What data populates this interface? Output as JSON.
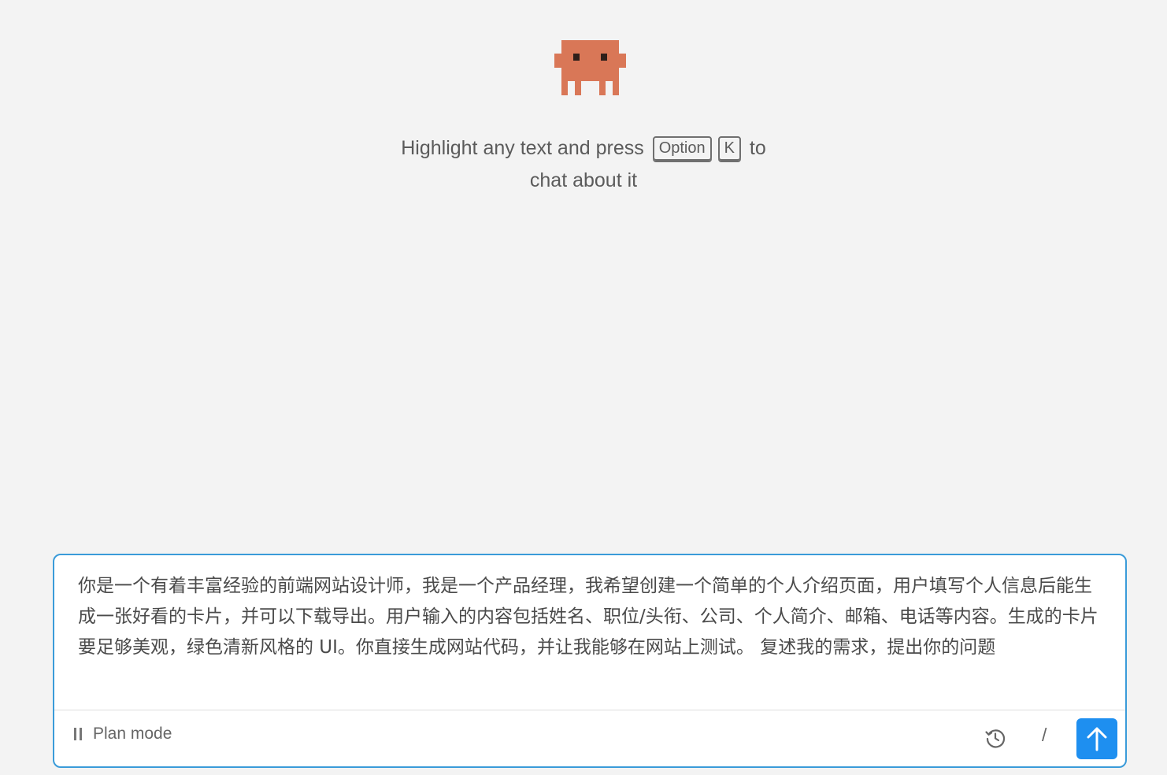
{
  "hint": {
    "line1_text": "Highlight any text and press",
    "key1": "Option",
    "key2": "K",
    "line1_suffix": "to",
    "line2": "chat about it"
  },
  "composer": {
    "prompt_value": "你是一个有着丰富经验的前端网站设计师，我是一个产品经理，我希望创建一个简单的个人介绍页面，用户填写个人信息后能生成一张好看的卡片，并可以下载导出。用户输入的内容包括姓名、职位/头衔、公司、个人简介、邮箱、电话等内容。生成的卡片要足够美观，绿色清新风格的 UI。你直接生成网站代码，并让我能够在网站上测试。 复述我的需求，提出你的问题",
    "mode_label": "Plan mode",
    "slash_label": "/",
    "icons": {
      "mode": "pause-icon",
      "history": "history-clock-icon",
      "send": "arrow-up-icon"
    }
  },
  "colors": {
    "mascot": "#d97757",
    "accent_border": "#3a9bd9",
    "send_button": "#1e8ff0",
    "background": "#f3f3f3"
  }
}
